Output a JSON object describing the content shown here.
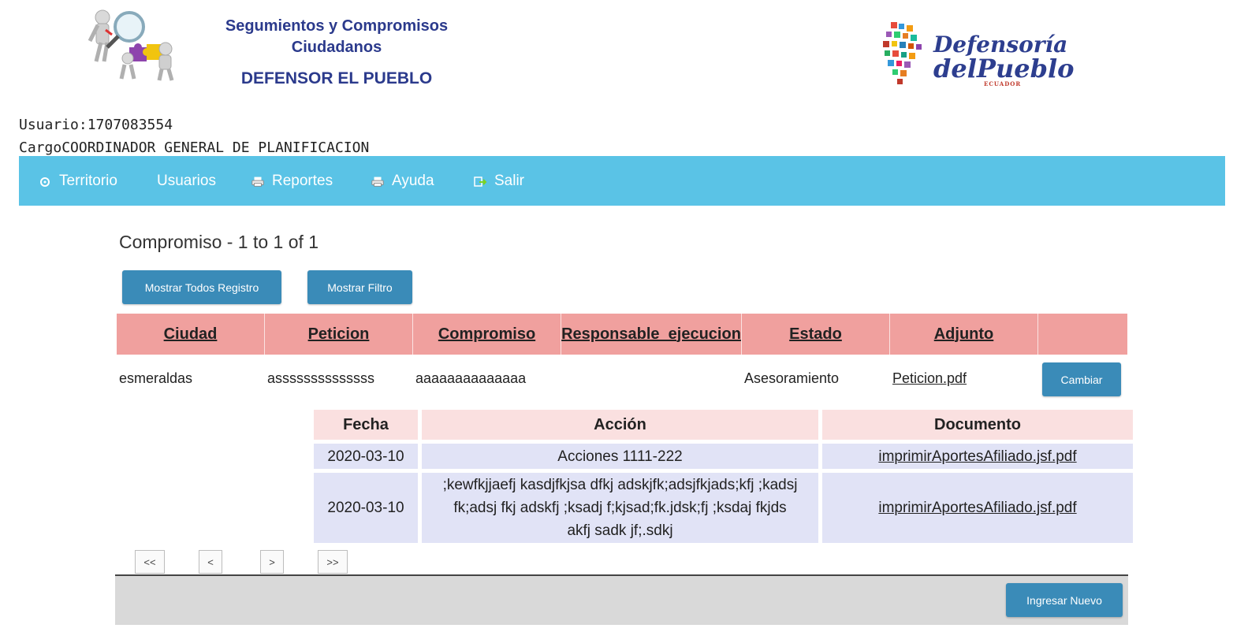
{
  "header": {
    "title_line1": "Segumientos y Compromisos",
    "title_line2": "Ciudadanos",
    "subtitle": "DEFENSOR EL PUEBLO",
    "logo_right": {
      "line1": "Defensoría",
      "line2": "delPueblo",
      "line3": "ECUADOR"
    }
  },
  "user": {
    "usuario_label": "Usuario:",
    "usuario_value": "1707083554",
    "cargo_label": "Cargo",
    "cargo_value": "COORDINADOR GENERAL DE PLANIFICACION"
  },
  "nav": {
    "items": [
      {
        "label": "Territorio",
        "icon": "gear-icon"
      },
      {
        "label": "Usuarios",
        "icon": ""
      },
      {
        "label": "Reportes",
        "icon": "printer-icon"
      },
      {
        "label": "Ayuda",
        "icon": "printer-icon"
      },
      {
        "label": "Salir",
        "icon": "exit-icon"
      }
    ]
  },
  "main": {
    "title": "Compromiso - 1 to 1 of 1",
    "btn_all": "Mostrar Todos Registro",
    "btn_filter": "Mostrar Filtro",
    "columns": [
      "Ciudad",
      "Peticion",
      "Compromiso",
      "Responsable_ejecucion",
      "Estado",
      "Adjunto",
      ""
    ],
    "row": {
      "ciudad": "esmeraldas",
      "peticion": "assssssssssssss",
      "compromiso": "aaaaaaaaaaaaaa",
      "responsable": "",
      "estado": "Asesoramiento",
      "adjunto": "Peticion.pdf",
      "cambiar": "Cambiar"
    },
    "sub_table": {
      "headers": [
        "Fecha",
        "Acción",
        "Documento"
      ],
      "rows": [
        {
          "fecha": "2020-03-10",
          "accion": "Acciones 1111-222",
          "documento": "imprimirAportesAfiliado.jsf.pdf"
        },
        {
          "fecha": "2020-03-10",
          "accion": ";kewfkjjaefj kasdjfkjsa dfkj adskjfk;adsjfkjads;kfj ;kadsj fk;adsj fkj adskfj ;ksadj f;kjsad;fk.jdsk;fj ;ksdaj fkjds akfj sadk jf;.sdkj",
          "documento": "imprimirAportesAfiliado.jsf.pdf"
        }
      ]
    },
    "pager": {
      "first": "<<",
      "prev": "<",
      "next": ">",
      "last": ">>"
    },
    "btn_new": "Ingresar Nuevo"
  },
  "colors": {
    "nav": "#5ac3e6",
    "button": "#3a8bb8",
    "grid_header": "#f0a09e",
    "sub_header": "#fae0e0",
    "sub_cell": "#e1e3f6"
  }
}
